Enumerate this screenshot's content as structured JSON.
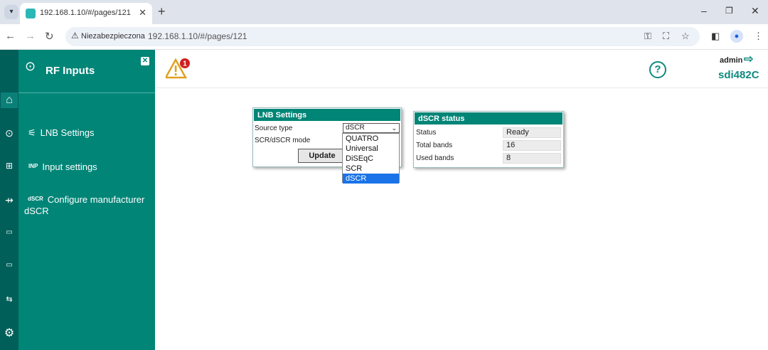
{
  "browser": {
    "tab_title": "192.168.1.10/#/pages/121",
    "tab_close": "✕",
    "new_tab": "+",
    "security_label": "Niezabezpieczona",
    "url": "192.168.1.10/#/pages/121"
  },
  "sidebar": {
    "title": "RF Inputs",
    "items": [
      {
        "label": "LNB Settings",
        "icon": "satellite-dish-icon"
      },
      {
        "label": "Input settings",
        "prefix": "INP",
        "icon": "input-settings-icon"
      },
      {
        "label": "Configure manufacturer dSCR",
        "prefix": "dSCR",
        "icon": "dscr-icon"
      }
    ]
  },
  "header": {
    "alert_count": "1",
    "user": "admin",
    "device": "sdi482C"
  },
  "lnb_settings": {
    "title": "LNB Settings",
    "source_type_label": "Source type",
    "source_type_value": "dSCR",
    "mode_label": "SCR/dSCR mode",
    "update_label": "Update",
    "options": [
      "QUATRO",
      "Universal",
      "DiSEqC",
      "SCR",
      "dSCR"
    ],
    "selected_option": "dSCR"
  },
  "dscr_status": {
    "title": "dSCR status",
    "rows": [
      {
        "label": "Status",
        "value": "Ready"
      },
      {
        "label": "Total bands",
        "value": "16"
      },
      {
        "label": "Used bands",
        "value": "8"
      }
    ]
  },
  "colors": {
    "sidebar": "#008577",
    "rail": "#005f59",
    "accent": "#0f8a7e",
    "selection": "#1a73e8"
  }
}
